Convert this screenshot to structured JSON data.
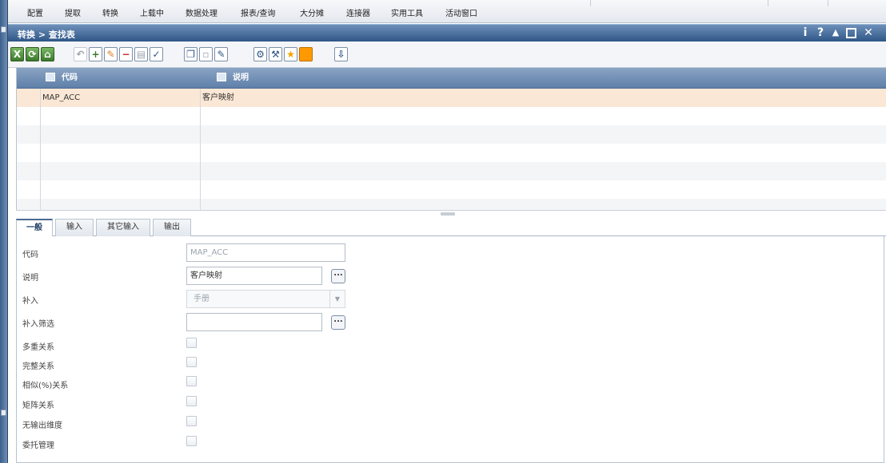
{
  "menubar": {
    "items": [
      {
        "label": "配置",
        "icon": "config-icon"
      },
      {
        "label": "提取",
        "icon": "extract-icon"
      },
      {
        "label": "转换",
        "icon": "transform-icon"
      },
      {
        "label": "上载中",
        "icon": "upload-icon"
      },
      {
        "label": "数据处理",
        "icon": "data-processing-icon"
      },
      {
        "label": "报表/查询",
        "icon": "report-icon"
      },
      {
        "label": "大分摊",
        "icon": "allocation-icon"
      },
      {
        "label": "连接器",
        "icon": "connector-icon"
      },
      {
        "label": "实用工具",
        "icon": "tools-icon"
      },
      {
        "label": "活动窗口",
        "icon": "window-icon"
      }
    ]
  },
  "window": {
    "title": "转换 > 查找表",
    "controls": {
      "info": "i",
      "help": "?",
      "collapse": "▲",
      "maximize": "▢",
      "close": "✕"
    }
  },
  "toolbar": {
    "buttons": [
      {
        "name": "excel-export-button",
        "icon": "excel-icon",
        "glyph": "X"
      },
      {
        "name": "refresh-data-button",
        "icon": "refresh-icon",
        "glyph": "⟳"
      },
      {
        "name": "home-button",
        "icon": "home-icon",
        "glyph": "⌂"
      },
      {
        "name": "undo-button",
        "icon": "undo-icon",
        "glyph": "↶"
      },
      {
        "name": "add-button",
        "icon": "add-icon",
        "glyph": "+"
      },
      {
        "name": "edit-button",
        "icon": "pencil-icon",
        "glyph": "✎"
      },
      {
        "name": "delete-button",
        "icon": "minus-icon",
        "glyph": "−"
      },
      {
        "name": "save-button",
        "icon": "save-icon",
        "glyph": "▤"
      },
      {
        "name": "check-button",
        "icon": "check-icon",
        "glyph": "✓"
      },
      {
        "name": "copy-button",
        "icon": "copy-icon",
        "glyph": "❐"
      },
      {
        "name": "paste-button",
        "icon": "paste-icon",
        "glyph": "▫"
      },
      {
        "name": "edit-doc-button",
        "icon": "edit-document-icon",
        "glyph": "✎"
      },
      {
        "name": "settings-button",
        "icon": "settings-icon",
        "glyph": "⚙"
      },
      {
        "name": "wrench-button",
        "icon": "wrench-icon",
        "glyph": "⚒"
      },
      {
        "name": "favorite-button",
        "icon": "star-icon",
        "glyph": "★"
      },
      {
        "name": "orange-square-button",
        "icon": "square-icon",
        "glyph": ""
      },
      {
        "name": "import-button",
        "icon": "import-icon",
        "glyph": "⇩"
      }
    ]
  },
  "grid": {
    "columns": [
      {
        "label": "代码",
        "icon": "search-icon"
      },
      {
        "label": "说明",
        "icon": "search-icon"
      }
    ],
    "rows": [
      {
        "code": "MAP_ACC",
        "desc": "客户映射",
        "selected": true
      }
    ]
  },
  "tabs": [
    {
      "label": "一般",
      "active": true
    },
    {
      "label": "输入",
      "active": false
    },
    {
      "label": "其它输入",
      "active": false
    },
    {
      "label": "输出",
      "active": false
    }
  ],
  "form": {
    "code": {
      "label": "代码",
      "value": "MAP_ACC"
    },
    "description": {
      "label": "说明",
      "value": "客户映射"
    },
    "supplement": {
      "label": "补入",
      "value": "手册"
    },
    "supplement_filter": {
      "label": "补入筛选",
      "value": ""
    },
    "checkboxes": [
      {
        "label": "多重关系",
        "checked": false
      },
      {
        "label": "完整关系",
        "checked": false
      },
      {
        "label": "相似(%)关系",
        "checked": false
      },
      {
        "label": "矩阵关系",
        "checked": false
      },
      {
        "label": "无输出维度",
        "checked": false
      },
      {
        "label": "委托管理",
        "checked": false
      }
    ],
    "dots_label": "..."
  },
  "colors": {
    "title_bar": "#2f5687",
    "grid_header": "#5f80a9",
    "selected_row": "#fbe7d5",
    "accent_green": "#3d7a2d",
    "accent_red": "#c62828",
    "accent_orange": "#ff9900"
  }
}
